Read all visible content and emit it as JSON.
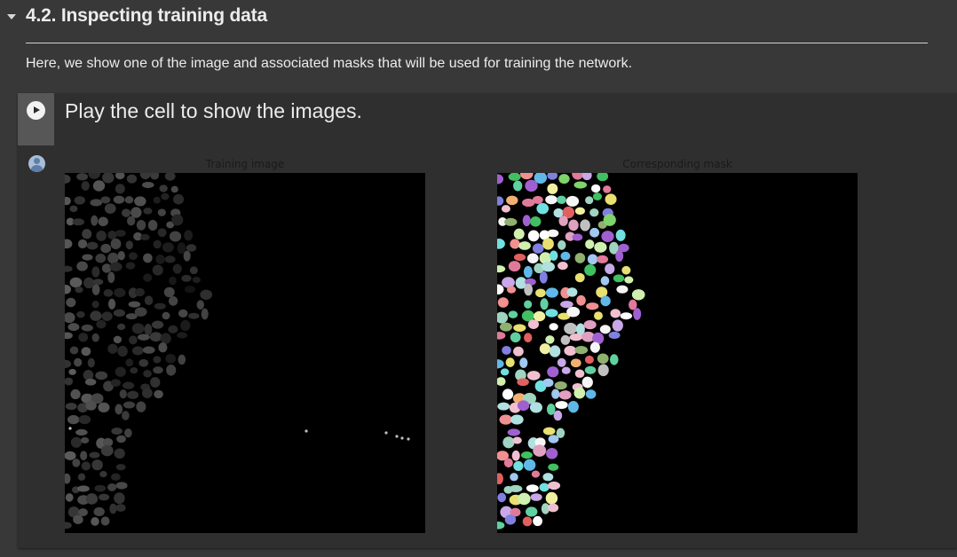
{
  "section": {
    "number_title": "4.2. Inspecting training data",
    "description": "Here, we show one of the image and associated masks that will be used for training the network."
  },
  "cell": {
    "form_title": "Play the cell to show the images."
  },
  "output": {
    "left_figure_title": "Training image",
    "right_figure_title": "Corresponding mask"
  },
  "colors": {
    "page_background": "#383838",
    "cell_background": "#2f2f2f",
    "gutter_background": "#575757",
    "image_background": "#000000"
  },
  "icons": {
    "collapse": "caret-down-icon",
    "run": "play-circle-icon",
    "output": "user-avatar-icon"
  }
}
